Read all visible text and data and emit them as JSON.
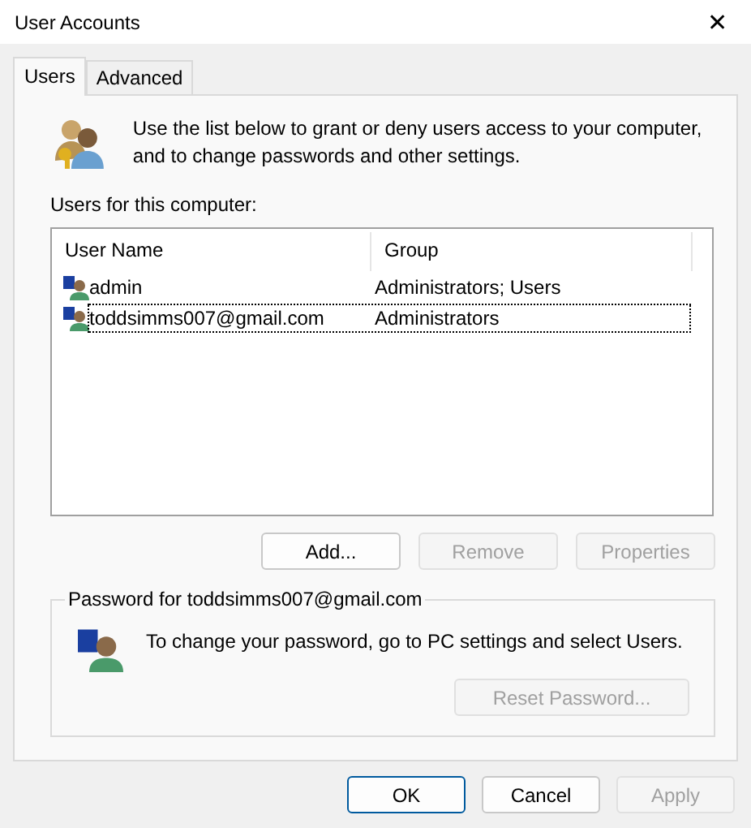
{
  "window": {
    "title": "User Accounts",
    "close": "✕"
  },
  "tabs": [
    {
      "label": "Users",
      "selected": true
    },
    {
      "label": "Advanced",
      "selected": false
    }
  ],
  "intro": "Use the list below to grant or deny users access to your computer, and to change passwords and other settings.",
  "users_label": "Users for this computer:",
  "table": {
    "columns": [
      "User Name",
      "Group"
    ],
    "rows": [
      {
        "name": "admin",
        "group": "Administrators; Users",
        "focused": false
      },
      {
        "name": "toddsimms007@gmail.com",
        "group": "Administrators",
        "focused": true
      }
    ]
  },
  "list_buttons": [
    {
      "label": "Add...",
      "disabled": false
    },
    {
      "label": "Remove",
      "disabled": true
    },
    {
      "label": "Properties",
      "disabled": true
    }
  ],
  "password": {
    "title": "Password for toddsimms007@gmail.com",
    "text": "To change your password, go to PC settings and select Users.",
    "button": {
      "label": "Reset Password...",
      "disabled": true
    }
  },
  "dialog_buttons": [
    {
      "label": "OK",
      "disabled": false,
      "default": true
    },
    {
      "label": "Cancel",
      "disabled": false,
      "default": false
    },
    {
      "label": "Apply",
      "disabled": true,
      "default": false
    }
  ]
}
